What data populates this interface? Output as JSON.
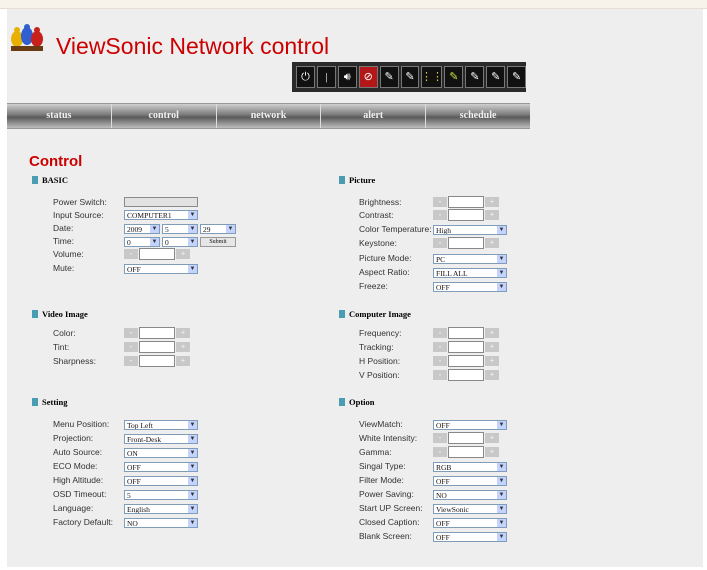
{
  "app": {
    "title": "ViewSonic Network control",
    "accent": "#cc0000"
  },
  "toolbar": {
    "icons": [
      "power-icon",
      "standby-icon",
      "volume-icon",
      "mute-icon",
      "video-plug-icon",
      "component-plug-icon",
      "rgb-icon",
      "pen-icon",
      "svideo-icon",
      "pen2-icon",
      "pen3-icon",
      "plug-icon"
    ]
  },
  "nav": {
    "items": [
      "status",
      "control",
      "network",
      "alert",
      "schedule"
    ]
  },
  "page_title": "Control",
  "basic": {
    "title": "BASIC",
    "power_switch": {
      "label": "Power Switch:"
    },
    "input_source": {
      "label": "Input Source:",
      "value": "COMPUTER1"
    },
    "date": {
      "label": "Date:",
      "year": "2009",
      "month": "5",
      "day": "29"
    },
    "time": {
      "label": "Time:",
      "hour": "0",
      "minute": "0",
      "submit": "Submit"
    },
    "volume": {
      "label": "Volume:"
    },
    "mute": {
      "label": "Mute:",
      "value": "OFF"
    }
  },
  "picture": {
    "title": "Picture",
    "brightness": {
      "label": "Brightness:"
    },
    "contrast": {
      "label": "Contrast:"
    },
    "color_temperature": {
      "label": "Color Temperature:",
      "value": "High"
    },
    "keystone": {
      "label": "Keystone:"
    },
    "picture_mode": {
      "label": "Picture Mode:",
      "value": "PC"
    },
    "aspect_ratio": {
      "label": "Aspect Ratio:",
      "value": "FILL ALL"
    },
    "freeze": {
      "label": "Freeze:",
      "value": "OFF"
    }
  },
  "video_image": {
    "title": "Video Image",
    "color": {
      "label": "Color:"
    },
    "tint": {
      "label": "Tint:"
    },
    "sharpness": {
      "label": "Sharpness:"
    }
  },
  "computer_image": {
    "title": "Computer Image",
    "frequency": {
      "label": "Frequency:"
    },
    "tracking": {
      "label": "Tracking:"
    },
    "h_position": {
      "label": "H Position:"
    },
    "v_position": {
      "label": "V Position:"
    }
  },
  "setting": {
    "title": "Setting",
    "menu_position": {
      "label": "Menu Position:",
      "value": "Top Left"
    },
    "projection": {
      "label": "Projection:",
      "value": "Front-Desk"
    },
    "auto_source": {
      "label": "Auto Source:",
      "value": "ON"
    },
    "eco_mode": {
      "label": "ECO Mode:",
      "value": "OFF"
    },
    "high_altitude": {
      "label": "High Altitude:",
      "value": "OFF"
    },
    "osd_timeout": {
      "label": "OSD Timeout:",
      "value": "5"
    },
    "language": {
      "label": "Language:",
      "value": "English"
    },
    "factory_default": {
      "label": "Factory Default:",
      "value": "NO"
    }
  },
  "option": {
    "title": "Option",
    "viewmatch": {
      "label": "ViewMatch:",
      "value": "OFF"
    },
    "white_intensity": {
      "label": "White Intensity:"
    },
    "gamma": {
      "label": "Gamma:"
    },
    "signal_type": {
      "label": "Singal Type:",
      "value": "RGB"
    },
    "filter_mode": {
      "label": "Filter Mode:",
      "value": "OFF"
    },
    "power_saving": {
      "label": "Power Saving:",
      "value": "NO"
    },
    "start_up_screen": {
      "label": "Start UP Screen:",
      "value": "ViewSonic"
    },
    "closed_caption": {
      "label": "Closed Caption:",
      "value": "OFF"
    },
    "blank_screen": {
      "label": "Blank Screen:",
      "value": "OFF"
    }
  },
  "controls": {
    "minus": "-",
    "plus": "+"
  }
}
